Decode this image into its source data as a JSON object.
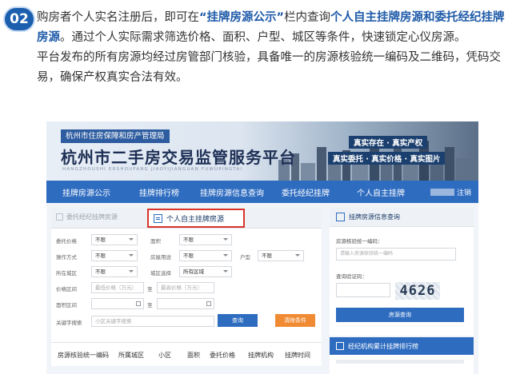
{
  "step": {
    "number": "02"
  },
  "intro": {
    "p1_a": "购房者个人实名注册后，即可在",
    "p1_quote": "“挂牌房源公示”",
    "p1_b": "栏内查询",
    "p1_bold": "个人自主挂牌房源和委托经纪挂牌房源",
    "p1_c": "。通过个人实际需求筛选价格、面积、户型、城区等条件，快速锁定心仪房源。",
    "p2": "平台发布的所有房源均经过房管部门核验，具备唯一的房源核验统一编码及二维码，凭码交易，确保产权真实合法有效。"
  },
  "banner": {
    "org": "杭州市住房保障和房产管理局",
    "title": "杭州市二手房交易监管服务平台",
    "pinyin": "HANGZHOUSHI ERSHOUFANG JIAOYIJIANGUAN FUWUPINGTAI",
    "slogan1": "真实存在 · 真实产权",
    "slogan2": "真实委托 · 真实价格 · 真实图片"
  },
  "nav": {
    "items": [
      "挂牌房源公示",
      "挂牌排行榜",
      "挂牌房源信息查询",
      "委托经纪挂牌",
      "个人自主挂牌"
    ],
    "user_suffix": "注销"
  },
  "search": {
    "tab_agent": "委托经纪挂牌房源",
    "tab_self": "个人自主挂牌房源",
    "labels": {
      "price": "委托价格",
      "area": "面积",
      "deal_method": "操作方式",
      "house_use": "房屋用途",
      "layout": "户型",
      "district": "所在城区",
      "region": "城区选择",
      "price_range": "价格区间",
      "area_range": "面积区间",
      "listing_time": "挂牌时间",
      "to": "至",
      "keyword": "关键字搜索"
    },
    "options": {
      "unlimited": "不限",
      "all_regions": "所有区域"
    },
    "placeholders": {
      "min_price": "最低价格（万元）",
      "max_price": "最高价格（万元）",
      "min_area": "最低面积",
      "max_area": "最高面积",
      "keyword": "小区关键字搜索"
    },
    "query_button": "查询",
    "reset_button": "清除条件"
  },
  "table": {
    "headers": [
      "房源核验统一编码",
      "所属城区",
      "小区",
      "面积",
      "委托价格",
      "挂牌机构",
      "挂牌时间"
    ]
  },
  "verify": {
    "title": "挂牌房源信息查询",
    "code_label": "房源核验统一编码：",
    "code_placeholder": "请输入房源核验统一编码",
    "captcha_label": "查询验证码：",
    "captcha_text": "4626",
    "button": "房源查询"
  },
  "ranking": {
    "title": "经纪机构累计挂牌排行榜"
  }
}
